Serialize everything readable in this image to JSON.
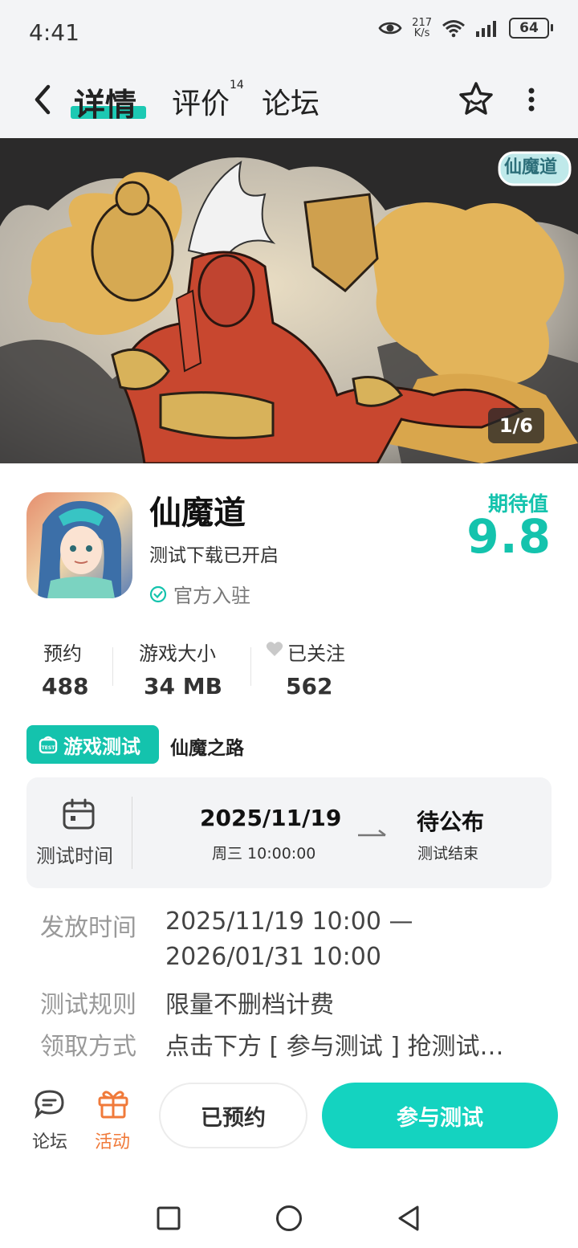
{
  "status_bar": {
    "time": "4:41",
    "net_speed_value": "217",
    "net_speed_unit": "K/s",
    "battery": "64",
    "icons": [
      "eye-icon",
      "wifi-icon",
      "signal-icon",
      "battery-icon"
    ]
  },
  "nav": {
    "tabs": [
      {
        "label": "详情",
        "active": true
      },
      {
        "label": "评价",
        "badge": "14"
      },
      {
        "label": "论坛"
      }
    ],
    "icons": [
      "back-icon",
      "star-icon",
      "more-icon"
    ],
    "accent": "#1cc9b3"
  },
  "banner": {
    "logo_text": "仙魔道",
    "page_indicator": "1/6"
  },
  "app": {
    "name": "仙魔道",
    "subtitle": "测试下载已开启",
    "official": "官方入驻",
    "expect_label": "期待值",
    "expect_value": "9.8"
  },
  "stats": [
    {
      "label": "预约",
      "value": "488"
    },
    {
      "label": "游戏大小",
      "value": "34 MB"
    },
    {
      "label": "已关注",
      "value": "562"
    }
  ],
  "test_tag": {
    "label": "游戏测试",
    "desc": "仙魔之路"
  },
  "test_time": {
    "label": "测试时间",
    "start_date": "2025/11/19",
    "start_sub": "周三  10:00:00",
    "end_date": "待公布",
    "end_sub": "测试结束"
  },
  "details": [
    {
      "label": "发放时间",
      "value": "2025/11/19 10:00 —",
      "value2": "2026/01/31 10:00"
    },
    {
      "label": "测试规则",
      "value": "限量不删档计费"
    },
    {
      "label": "领取方式",
      "value": "点击下方 [ 参与测试 ] 抢测试…"
    }
  ],
  "bottom_bar": {
    "forum_label": "论坛",
    "activity_label": "活动",
    "reserved_button": "已预约",
    "join_button": "参与测试",
    "activity_color": "#f07a3a",
    "join_color": "#14d3c0"
  }
}
